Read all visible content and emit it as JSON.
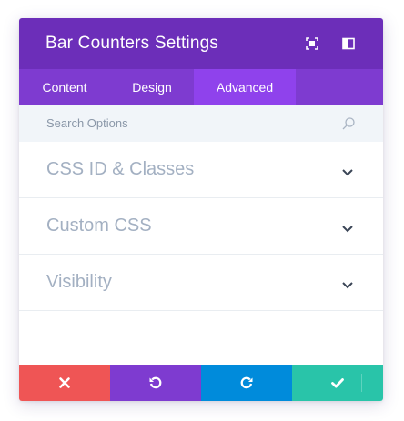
{
  "modal": {
    "title": "Bar Counters Settings"
  },
  "header_icons": [
    "expand-icon",
    "split-view-icon"
  ],
  "tabs": [
    {
      "label": "Content",
      "active": false
    },
    {
      "label": "Design",
      "active": false
    },
    {
      "label": "Advanced",
      "active": true
    }
  ],
  "search": {
    "placeholder": "Search Options"
  },
  "options": [
    {
      "label": "CSS ID & Classes"
    },
    {
      "label": "Custom CSS"
    },
    {
      "label": "Visibility"
    }
  ],
  "footer_buttons": [
    "close-icon",
    "undo-icon",
    "redo-icon",
    "checkmark-icon"
  ],
  "colors": {
    "header": "#6c2eb9",
    "tabs": "#7e3bd0",
    "active_tab": "#8f42ec",
    "cancel": "#ef5555",
    "undo": "#7e3bd0",
    "redo": "#008bdb",
    "save": "#29c4a9"
  }
}
